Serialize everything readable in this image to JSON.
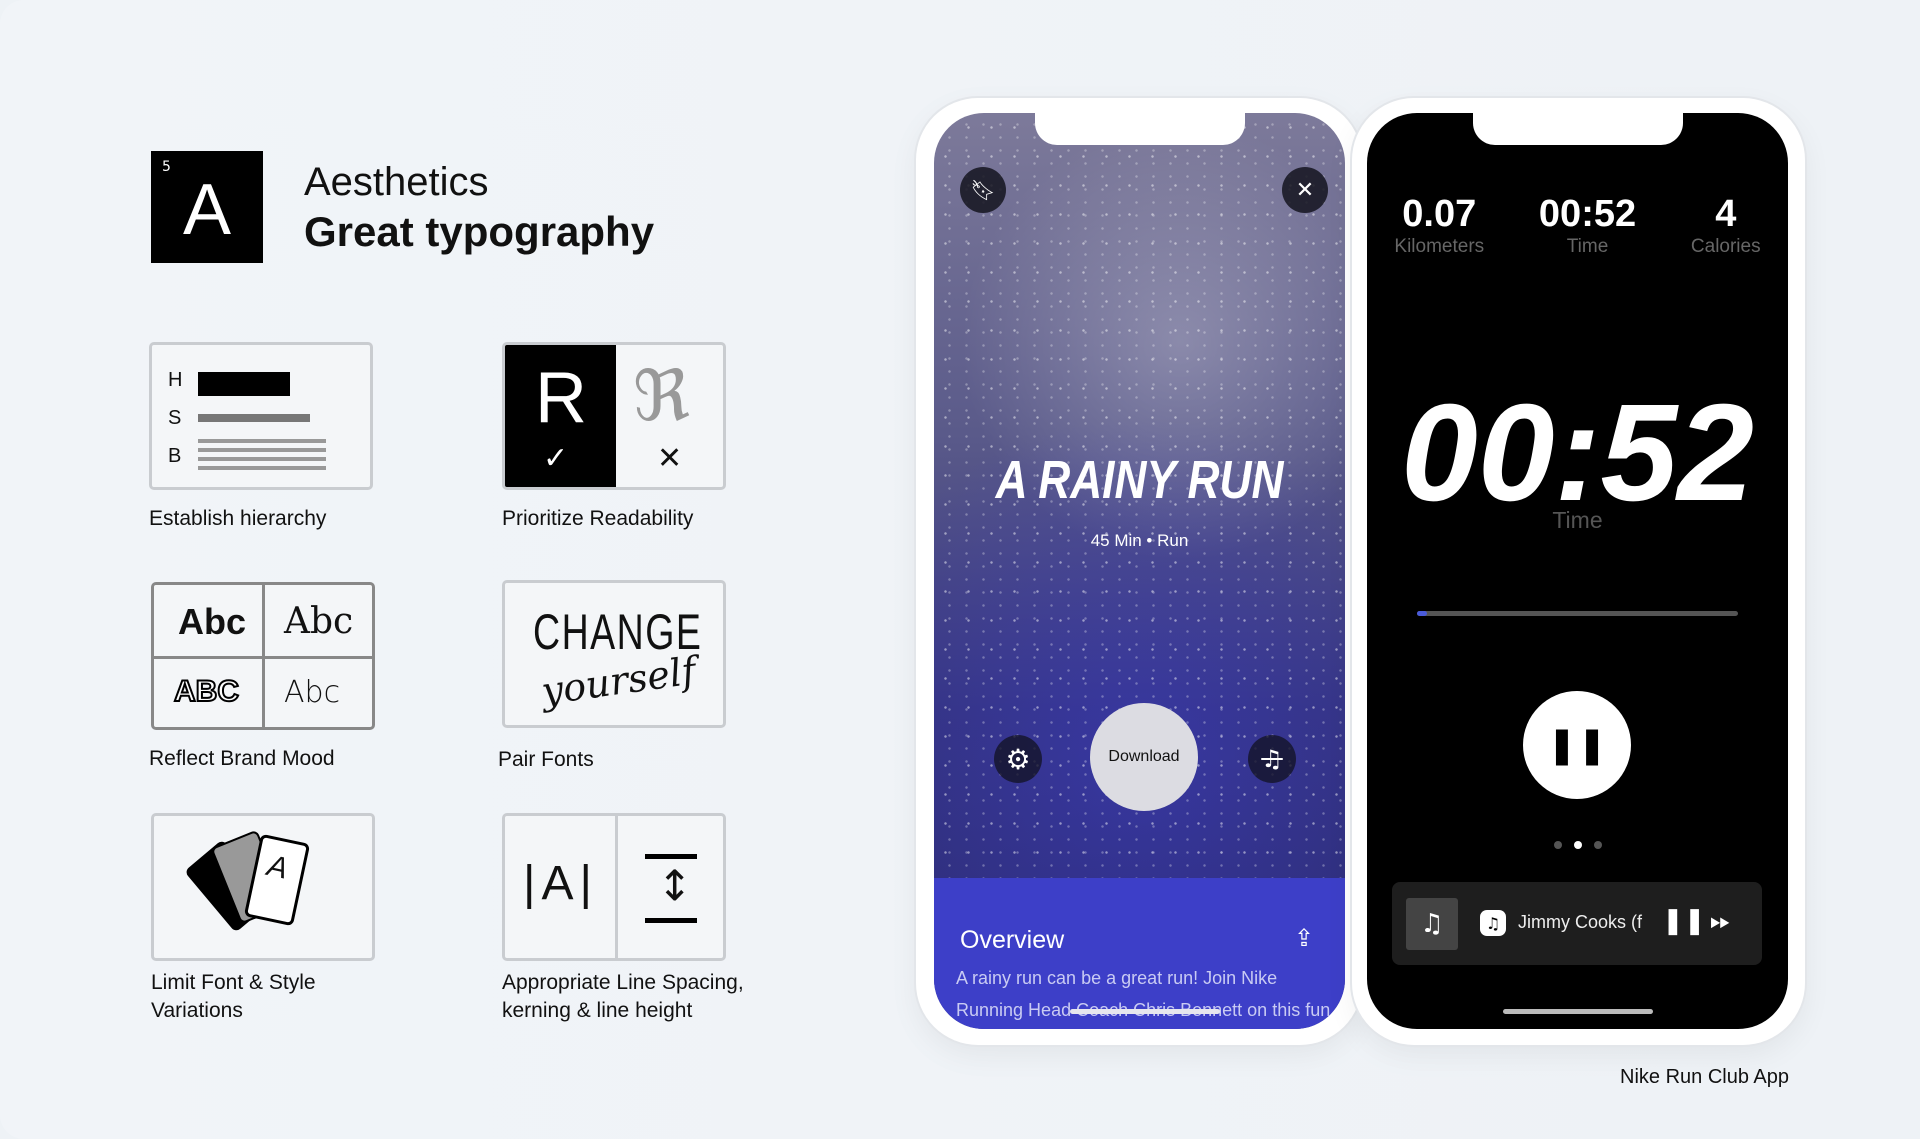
{
  "header": {
    "badge_number": "5",
    "badge_letter": "A",
    "category": "Aesthetics",
    "title": "Great typography"
  },
  "principles": [
    {
      "label": "Establish hierarchy",
      "letters": [
        "H",
        "S",
        "B"
      ]
    },
    {
      "label": "Prioritize Readability",
      "good": "R",
      "bad": "ℜ"
    },
    {
      "label": "Reflect Brand Mood",
      "samples": [
        "Abc",
        "Abc",
        "ABC",
        "Abc"
      ]
    },
    {
      "label": "Pair Fonts",
      "display": "CHANGE",
      "script": "yourself"
    },
    {
      "label_line1": "Limit Font & Style",
      "label_line2": "Variations",
      "card_letter": "A"
    },
    {
      "label_line1": "Appropriate Line Spacing,",
      "label_line2": "kerning & line height",
      "kern_sample": "|A|"
    }
  ],
  "phone1": {
    "title": "A RAINY RUN",
    "subtitle": "45 Min • Run",
    "download": "Download",
    "overview": "Overview",
    "desc_line1": "A rainy run can be a great run! Join Nike",
    "desc_line2": "Running Head Coach Chris Bennett on this fun",
    "panel_color": "#3d3fc8"
  },
  "phone2": {
    "stats": [
      {
        "value": "0.07",
        "label": "Kilometers"
      },
      {
        "value": "00:52",
        "label": "Time"
      },
      {
        "value": "4",
        "label": "Calories"
      }
    ],
    "timer": "00:52",
    "timer_label": "Time",
    "progress": 0.03,
    "song": "Jimmy Cooks (f",
    "page_index": 1,
    "page_count": 3
  },
  "caption": "Nike Run Club App"
}
